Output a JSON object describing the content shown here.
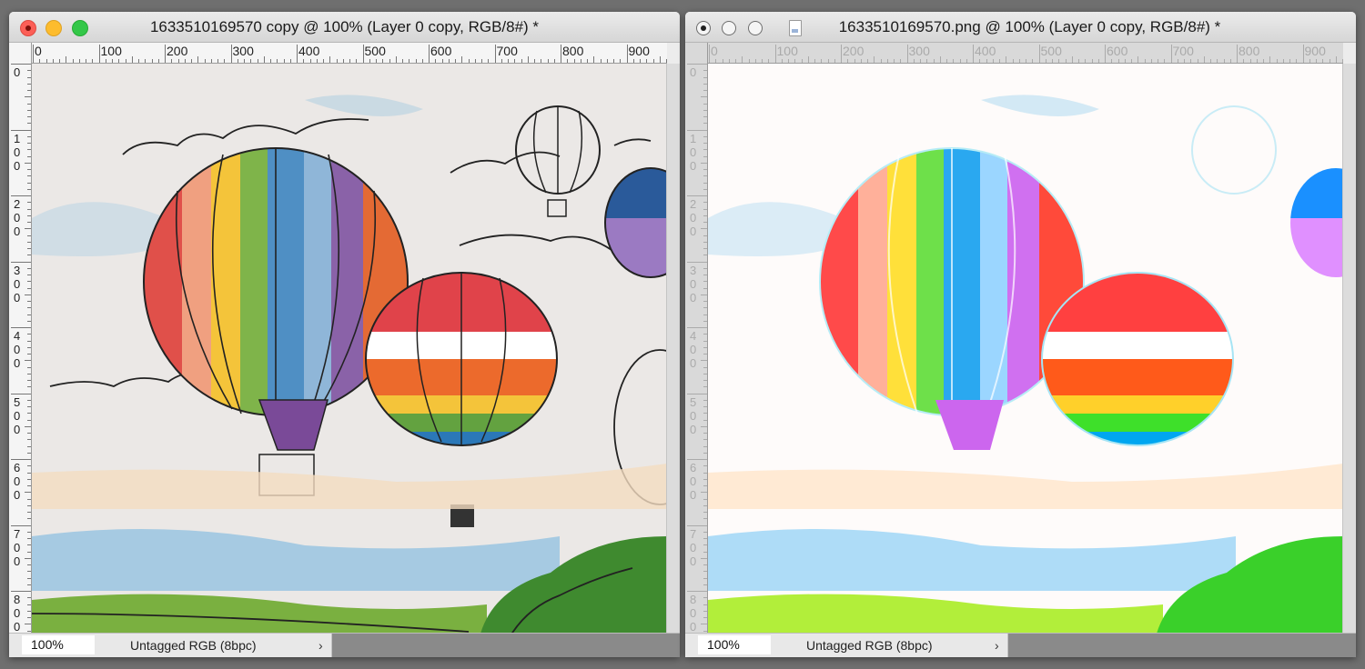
{
  "windows": [
    {
      "id": "left",
      "title": "1633510169570 copy @ 100% (Layer 0 copy, RGB/8#) *",
      "zoom": "100%",
      "doc_info": "Untagged RGB (8bpc)",
      "info_arrow": "›",
      "ruler_h": [
        "0",
        "100",
        "200",
        "300",
        "400",
        "500",
        "600",
        "700",
        "800",
        "900"
      ],
      "ruler_v": [
        "0",
        "100",
        "200",
        "300",
        "400",
        "500",
        "600",
        "700",
        "800"
      ]
    },
    {
      "id": "right",
      "title": "1633510169570.png @ 100% (Layer 0 copy, RGB/8#) *",
      "zoom": "100%",
      "doc_info": "Untagged RGB (8bpc)",
      "info_arrow": "›",
      "ruler_h": [
        "0",
        "100",
        "200",
        "300",
        "400",
        "500",
        "600",
        "700",
        "800",
        "900"
      ],
      "ruler_v": [
        "0",
        "100",
        "200",
        "300",
        "400",
        "500",
        "600",
        "700",
        "800"
      ]
    }
  ],
  "colors": {
    "close": "#fc5f57",
    "minimize": "#fdbc2e",
    "maximize": "#33c748",
    "left_canvas_bg": "#ebe8e6",
    "right_canvas_bg": "#fefbfa"
  }
}
